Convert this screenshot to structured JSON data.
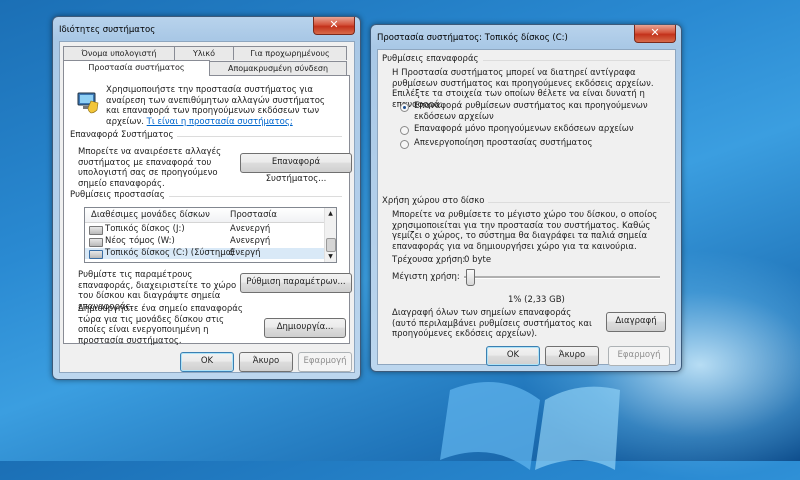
{
  "left_window": {
    "title": "Ιδιότητες συστήματος",
    "tabs_row1": [
      "Όνομα υπολογιστή",
      "Υλικό",
      "Για προχωρημένους"
    ],
    "tabs_row2": [
      "Προστασία συστήματος",
      "Απομακρυσμένη σύνδεση"
    ],
    "intro_text": "Χρησιμοποιήστε την προστασία συστήματος για αναίρεση των ανεπιθύμητων αλλαγών συστήματος και επαναφορά των προηγούμενων εκδόσεων των αρχείων.",
    "intro_link": "Τι είναι η προστασία συστήματος;",
    "restore_section": "Επαναφορά Συστήματος",
    "restore_text": "Μπορείτε να αναιρέσετε αλλαγές συστήματος με επαναφορά του υπολογιστή σας σε προηγούμενο σημείο επαναφοράς.",
    "restore_button": "Επαναφορά Συστήματος...",
    "settings_section": "Ρυθμίσεις προστασίας",
    "list_headers": [
      "Διαθέσιμες μονάδες δίσκων",
      "Προστασία"
    ],
    "drives": [
      {
        "name": "Τοπικός δίσκος (J:)",
        "status": "Ανενεργή"
      },
      {
        "name": "Νέος τόμος (W:)",
        "status": "Ανενεργή"
      },
      {
        "name": "Τοπικός δίσκος (C:) (Σύστημα)",
        "status": "Ενεργή"
      }
    ],
    "configure_text": "Ρυθμίστε τις παραμέτρους επαναφοράς, διαχειριστείτε το χώρο του δίσκου και διαγράψτε σημεία επαναφοράς.",
    "configure_button": "Ρύθμιση παραμέτρων...",
    "create_text": "Δημιουργήστε ένα σημείο επαναφοράς τώρα για τις μονάδες δίσκου στις οποίες είναι ενεργοποιημένη η προστασία συστήματος.",
    "create_button": "Δημιουργία...",
    "ok": "OK",
    "cancel": "Άκυρο",
    "apply": "Εφαρμογή",
    "close_glyph": "✕"
  },
  "right_window": {
    "title": "Προστασία συστήματος: Τοπικός δίσκος (C:)",
    "restore_settings_section": "Ρυθμίσεις επαναφοράς",
    "restore_settings_text": "Η Προστασία συστήματος μπορεί να διατηρεί αντίγραφα ρυθμίσεων συστήματος και προηγούμενες εκδόσεις αρχείων. Επιλέξτε τα στοιχεία των οποίων θέλετε να είναι δυνατή η επαναφορά:",
    "radio_options": [
      "Επαναφορά ρυθμίσεων συστήματος και προηγούμενων εκδόσεων αρχείων",
      "Επαναφορά μόνο προηγούμενων εκδόσεων αρχείων",
      "Απενεργοποίηση προστασίας συστήματος"
    ],
    "radio_selected_index": 0,
    "disk_usage_section": "Χρήση χώρου στο δίσκο",
    "disk_usage_text": "Μπορείτε να ρυθμίσετε το μέγιστο χώρο του δίσκου, ο οποίος χρησιμοποιείται για την προστασία του συστήματος. Καθώς γεμίζει ο χώρος, το σύστημα θα διαγράφει τα παλιά σημεία επαναφοράς για να δημιουργήσει χώρο για τα καινούρια.",
    "current_usage_label": "Τρέχουσα χρήση:",
    "current_usage_value": "0 byte",
    "max_usage_label": "Μέγιστη χρήση:",
    "max_usage_fraction": 0.01,
    "max_usage_value": "1% (2,33 GB)",
    "delete_text": "Διαγραφή όλων των σημείων επαναφοράς (αυτό περιλαμβάνει ρυθμίσεις συστήματος και προηγούμενες εκδόσεις αρχείων).",
    "delete_button": "Διαγραφή",
    "ok": "OK",
    "cancel": "Άκυρο",
    "apply": "Εφαρμογή",
    "close_glyph": "✕"
  },
  "colors": {
    "accent_link": "#0066cc",
    "desktop_blue": "#2a8ad2",
    "close_red": "#c3321b"
  }
}
